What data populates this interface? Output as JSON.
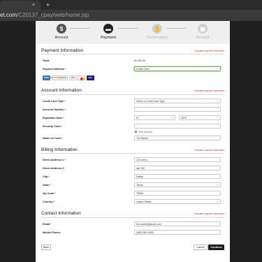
{
  "browser": {
    "tab_close": "×",
    "new_tab": "+",
    "url_domain": "et.com",
    "url_path": "/C20137_cpay/web/home.jsp"
  },
  "steps": [
    {
      "label": "Amount",
      "icon": "$"
    },
    {
      "label": "Payment",
      "icon": "▬"
    },
    {
      "label": "Confirmation",
      "icon": "✋"
    },
    {
      "label": "Receipt",
      "icon": "▤"
    }
  ],
  "required_note": "* Indicates required information",
  "payment": {
    "title": "Payment Information",
    "total_label": "Total:",
    "total_value": "$1,000.00",
    "method_label": "Payment Method:",
    "method_value": "Credit Card"
  },
  "card_brands": [
    "AMEX",
    "DISCOVER",
    "Diners",
    "JCB",
    "",
    "VISA"
  ],
  "account": {
    "title": "Account Information",
    "card_type_label": "Credit Card Type:",
    "card_type_value": "Select a Credit Card Type",
    "account_number_label": "Account Number:",
    "account_number_value": "",
    "expiration_label": "Expiration Date:",
    "exp_month": "07",
    "exp_year": "2023",
    "security_label": "Security Code:",
    "security_value": "",
    "view_example": "View Example",
    "name_label": "Name on Card:",
    "name_value": "Tim Martin"
  },
  "billing": {
    "title": "Billing Information",
    "addr1_label": "Street Address 1:",
    "addr1_value": "123 ave a",
    "addr2_label": "Street Address 2:",
    "addr2_value": "apt 100",
    "city_label": "City:",
    "city_value": "Dallas",
    "state_label": "State:",
    "state_value": "Texas",
    "zip_label": "Zip Code:",
    "zip_value": "75006",
    "country_label": "Country:",
    "country_value": "United States"
  },
  "contact": {
    "title": "Contact Information",
    "email_label": "Email:",
    "email_value": "tim.martin@gmail.com",
    "phone_label": "Mobile Phone:",
    "phone_value": "(555) 555-5555"
  },
  "buttons": {
    "back": "Back",
    "cancel": "Cancel",
    "continue": "Continue"
  }
}
